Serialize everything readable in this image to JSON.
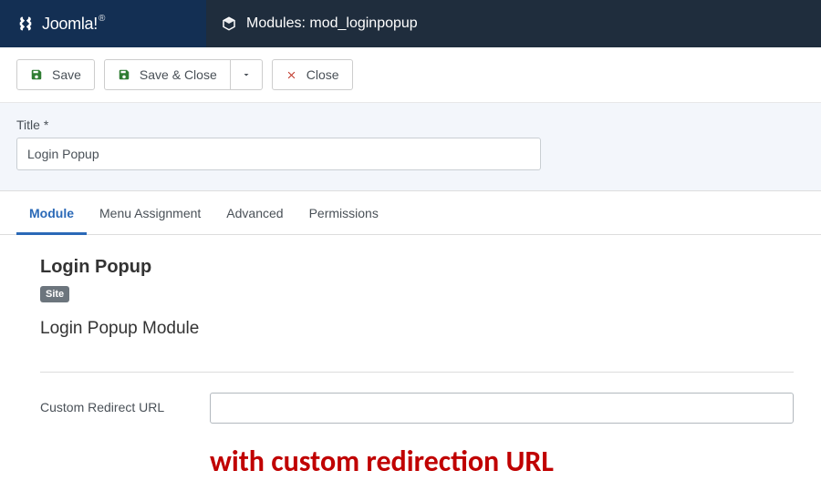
{
  "brand": {
    "name": "Joomla!",
    "reg": "®"
  },
  "header": {
    "title": "Modules: mod_loginpopup"
  },
  "toolbar": {
    "save": "Save",
    "save_close": "Save & Close",
    "close": "Close"
  },
  "form": {
    "title_label": "Title *",
    "title_value": "Login Popup"
  },
  "tabs": {
    "module": "Module",
    "menu_assignment": "Menu Assignment",
    "advanced": "Advanced",
    "permissions": "Permissions"
  },
  "module": {
    "heading": "Login Popup",
    "badge": "Site",
    "description": "Login Popup Module",
    "field_label": "Custom Redirect URL",
    "field_value": ""
  },
  "annotation": "with custom redirection URL"
}
